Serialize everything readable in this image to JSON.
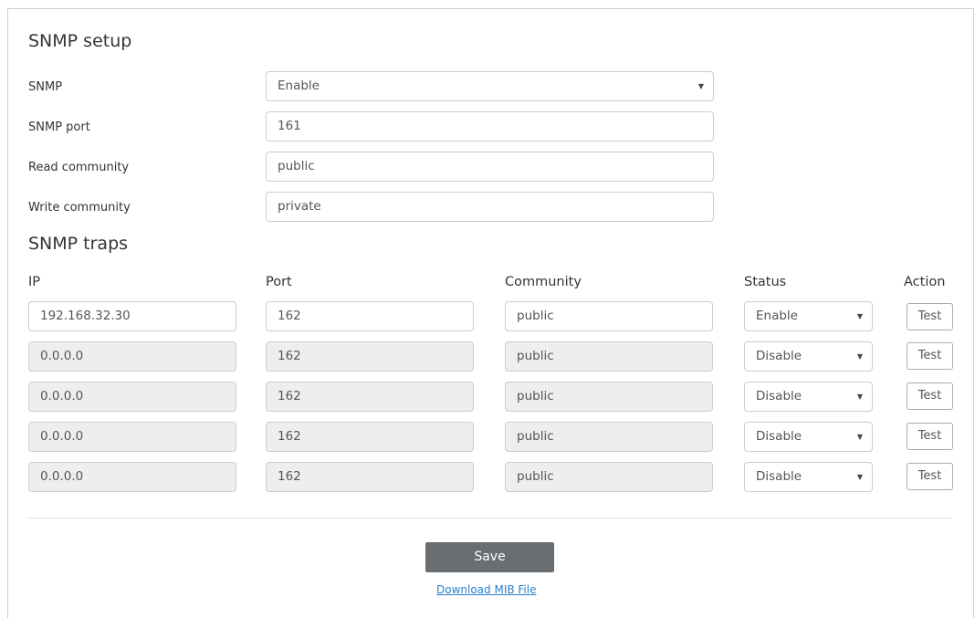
{
  "setup": {
    "title": "SNMP setup",
    "fields": [
      {
        "label": "SNMP",
        "value": "Enable",
        "type": "select"
      },
      {
        "label": "SNMP port",
        "value": "161",
        "type": "text"
      },
      {
        "label": "Read community",
        "value": "public",
        "type": "text"
      },
      {
        "label": "Write community",
        "value": "private",
        "type": "text"
      }
    ]
  },
  "traps": {
    "title": "SNMP traps",
    "columns": {
      "ip": "IP",
      "port": "Port",
      "community": "Community",
      "status": "Status",
      "action": "Action"
    },
    "rows": [
      {
        "ip": "192.168.32.30",
        "port": "162",
        "community": "public",
        "status": "Enable",
        "action": "Test",
        "disabled": false
      },
      {
        "ip": "0.0.0.0",
        "port": "162",
        "community": "public",
        "status": "Disable",
        "action": "Test",
        "disabled": true
      },
      {
        "ip": "0.0.0.0",
        "port": "162",
        "community": "public",
        "status": "Disable",
        "action": "Test",
        "disabled": true
      },
      {
        "ip": "0.0.0.0",
        "port": "162",
        "community": "public",
        "status": "Disable",
        "action": "Test",
        "disabled": true
      },
      {
        "ip": "0.0.0.0",
        "port": "162",
        "community": "public",
        "status": "Disable",
        "action": "Test",
        "disabled": true
      }
    ]
  },
  "footer": {
    "save_label": "Save",
    "download_label": "Download MIB File"
  },
  "colors": {
    "save_button": "#686e72",
    "link": "#2a7fc9",
    "disabled_field": "#eeeeee"
  },
  "icons": {
    "dropdown": "chevron-down-icon"
  }
}
